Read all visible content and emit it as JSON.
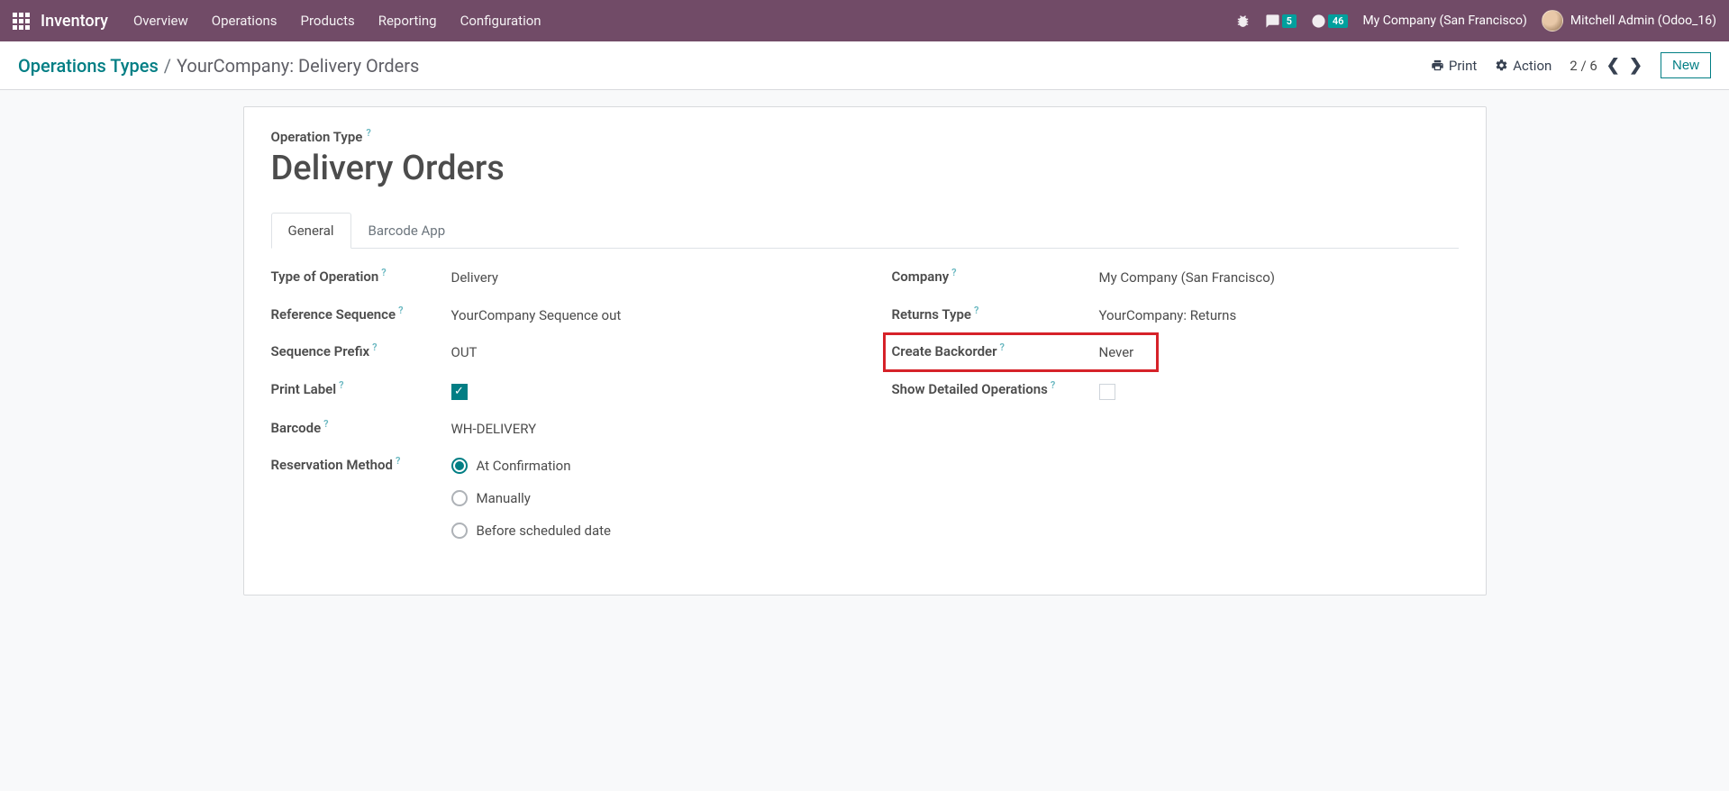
{
  "nav": {
    "brand": "Inventory",
    "menu": [
      "Overview",
      "Operations",
      "Products",
      "Reporting",
      "Configuration"
    ],
    "chat_badge": "5",
    "activity_badge": "46",
    "company": "My Company (San Francisco)",
    "user": "Mitchell Admin (Odoo_16)"
  },
  "control_panel": {
    "breadcrumb_root": "Operations Types",
    "breadcrumb_current": "YourCompany: Delivery Orders",
    "print_label": "Print",
    "action_label": "Action",
    "pager": "2 / 6",
    "new_label": "New"
  },
  "form": {
    "title_label": "Operation Type",
    "title": "Delivery Orders",
    "tabs": [
      "General",
      "Barcode App"
    ],
    "left": {
      "type_of_operation_label": "Type of Operation",
      "type_of_operation_value": "Delivery",
      "reference_sequence_label": "Reference Sequence",
      "reference_sequence_value": "YourCompany Sequence out",
      "sequence_prefix_label": "Sequence Prefix",
      "sequence_prefix_value": "OUT",
      "print_label_label": "Print Label",
      "barcode_label": "Barcode",
      "barcode_value": "WH-DELIVERY",
      "reservation_method_label": "Reservation Method",
      "reservation_options": [
        "At Confirmation",
        "Manually",
        "Before scheduled date"
      ]
    },
    "right": {
      "company_label": "Company",
      "company_value": "My Company (San Francisco)",
      "returns_type_label": "Returns Type",
      "returns_type_value": "YourCompany: Returns",
      "create_backorder_label": "Create Backorder",
      "create_backorder_value": "Never",
      "show_detailed_operations_label": "Show Detailed Operations"
    }
  }
}
